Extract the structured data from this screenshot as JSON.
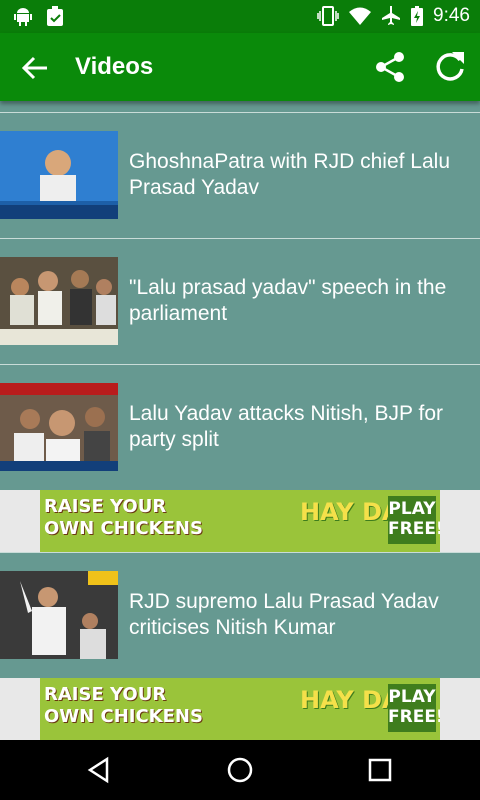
{
  "status": {
    "time": "9:46"
  },
  "toolbar": {
    "title": "Videos"
  },
  "videos": [
    {
      "title": "GhoshnaPatra with RJD chief Lalu Prasad Yadav"
    },
    {
      "title": "\"Lalu prasad yadav\"  speech in the parliament"
    },
    {
      "title": "Lalu Yadav attacks Nitish, BJP for party split"
    },
    {
      "title": "RJD supremo Lalu Prasad Yadav criticises Nitish Kumar"
    }
  ],
  "ads": [
    {
      "left": "RAISE YOUR\nOWN CHICKENS",
      "mid": "HAY DAY",
      "right": "PLAY FREE!"
    },
    {
      "left": "RAISE YOUR\nOWN CHICKENS",
      "mid": "HAY DAY",
      "right": "PLAY FREE!"
    }
  ],
  "colors": {
    "status_bar": "#0a7d09",
    "toolbar": "#0a8a0a",
    "list_bg": "#669991",
    "nav_bar": "#000000"
  },
  "icons": [
    "android-icon",
    "clipboard-icon",
    "vibrate-icon",
    "wifi-icon",
    "airplane-icon",
    "battery-icon",
    "back-arrow-icon",
    "share-icon",
    "refresh-icon",
    "nav-back-icon",
    "nav-home-icon",
    "nav-recent-icon"
  ]
}
